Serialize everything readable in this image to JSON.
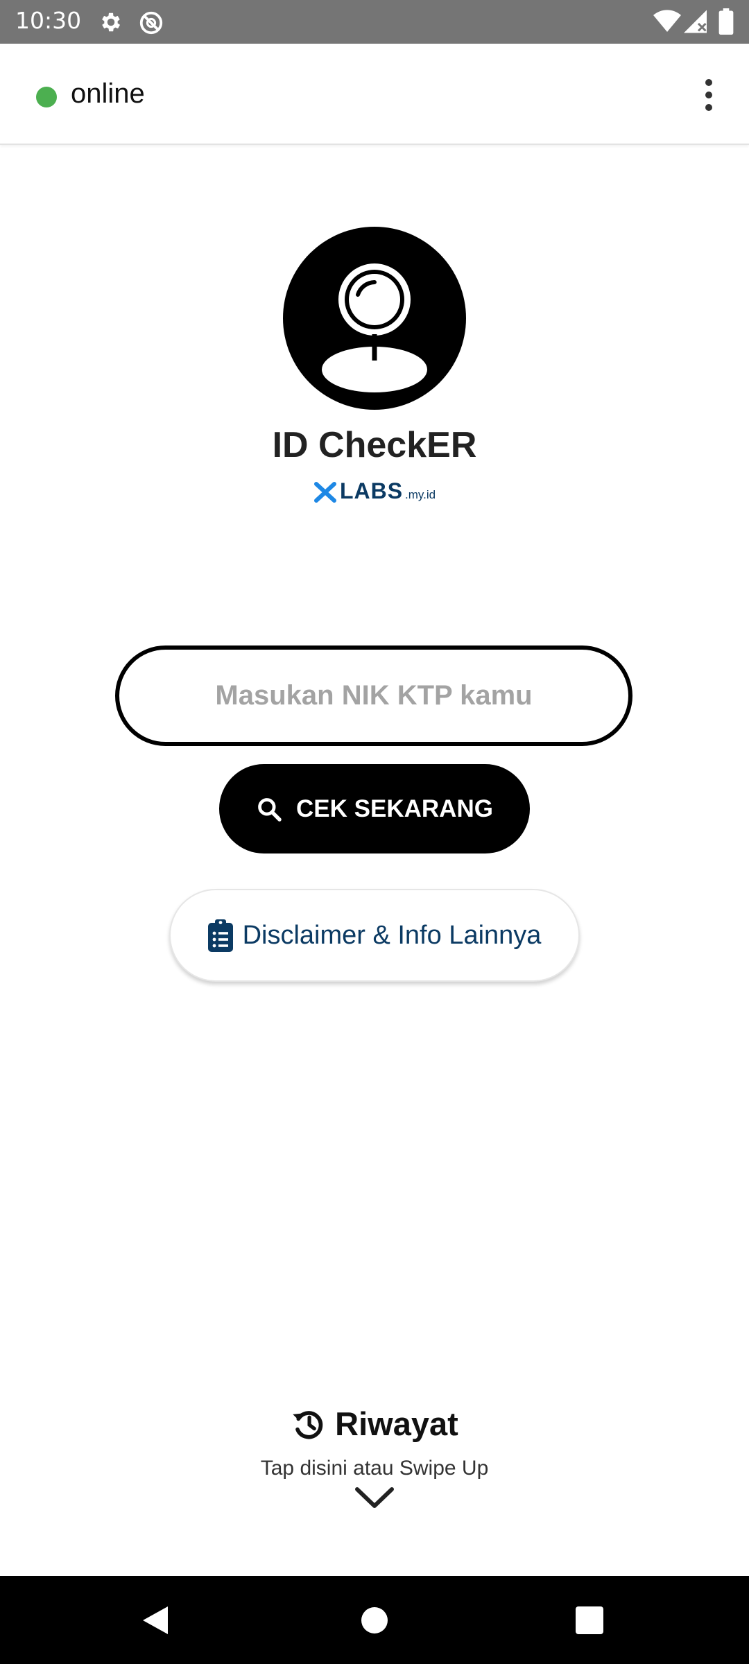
{
  "status_bar": {
    "time": "10:30",
    "icons": [
      "gear-icon",
      "do-not-disturb-icon",
      "wifi-icon",
      "signal-icon",
      "battery-icon"
    ]
  },
  "app_bar": {
    "connection_status": "online",
    "status_color": "#4caf50",
    "menu_icon": "more-vert-icon"
  },
  "logo": {
    "icon": "person-search-icon",
    "app_name": "ID CheckER",
    "brand_name": "LABS",
    "brand_suffix": ".my.id",
    "brand_color": "#0b3a63",
    "brand_mark_color": "#1e88e5"
  },
  "search": {
    "placeholder": "Masukan NIK KTP kamu",
    "value": ""
  },
  "check_button": {
    "icon": "search-icon",
    "label": "CEK SEKARANG"
  },
  "disclaimer_button": {
    "icon": "clipboard-list-icon",
    "label": "Disclaimer & Info Lainnya"
  },
  "history": {
    "icon": "history-icon",
    "title": "Riwayat",
    "hint": "Tap disini atau Swipe Up",
    "chevron_icon": "chevron-down-icon"
  },
  "nav_bar": {
    "icons": [
      "back-icon",
      "home-icon",
      "recents-icon"
    ]
  }
}
